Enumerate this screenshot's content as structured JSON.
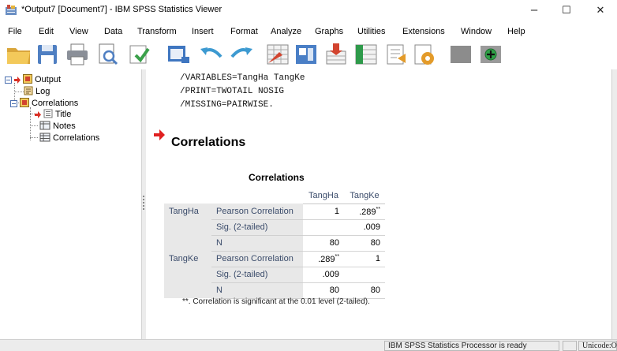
{
  "window": {
    "title": "*Output7 [Document7] - IBM SPSS Statistics Viewer",
    "minimize": "–",
    "maximize": "☐",
    "close": "✕"
  },
  "menu": [
    "File",
    "Edit",
    "View",
    "Data",
    "Transform",
    "Insert",
    "Format",
    "Analyze",
    "Graphs",
    "Utilities",
    "Extensions",
    "Window",
    "Help"
  ],
  "toolbar_icons": [
    "open-icon",
    "save-icon",
    "print-icon",
    "print-preview-icon",
    "export-icon",
    "recall-dialog-icon",
    "undo-icon",
    "redo-icon",
    "goto-data-icon",
    "goto-case-icon",
    "variables-icon",
    "select-cases-icon",
    "insert-output-icon",
    "designate-window-icon",
    "promote-icon",
    "demote-icon"
  ],
  "outline": {
    "root": "Output",
    "log": "Log",
    "correlations_node": "Correlations",
    "title": "Title",
    "notes": "Notes",
    "correlations_table": "Correlations"
  },
  "syntax_lines": [
    "/VARIABLES=TangHa TangKe",
    "/PRINT=TWOTAIL NOSIG",
    "/MISSING=PAIRWISE."
  ],
  "section_heading": "Correlations",
  "table": {
    "title": "Correlations",
    "columns": [
      "TangHa",
      "TangKe"
    ],
    "rows": [
      {
        "var": "TangHa",
        "stat": "Pearson Correlation",
        "c1": "1",
        "c2": ".289",
        "c2_sup": "**"
      },
      {
        "var": "",
        "stat": "Sig. (2-tailed)",
        "c1": "",
        "c2": ".009"
      },
      {
        "var": "",
        "stat": "N",
        "c1": "80",
        "c2": "80"
      },
      {
        "var": "TangKe",
        "stat": "Pearson Correlation",
        "c1": ".289",
        "c1_sup": "**",
        "c2": "1"
      },
      {
        "var": "",
        "stat": "Sig. (2-tailed)",
        "c1": ".009",
        "c2": ""
      },
      {
        "var": "",
        "stat": "N",
        "c1": "80",
        "c2": "80"
      }
    ],
    "footnote": "**. Correlation is significant at the 0.01 level (2-tailed)."
  },
  "status": {
    "processor": "IBM SPSS Statistics Processor is ready",
    "unicode": "Unicode:ON"
  },
  "colors": {
    "heading_arrow": "#e02020",
    "row_label_bg": "#e8e8e8",
    "row_label_text": "#3b4c6b"
  }
}
